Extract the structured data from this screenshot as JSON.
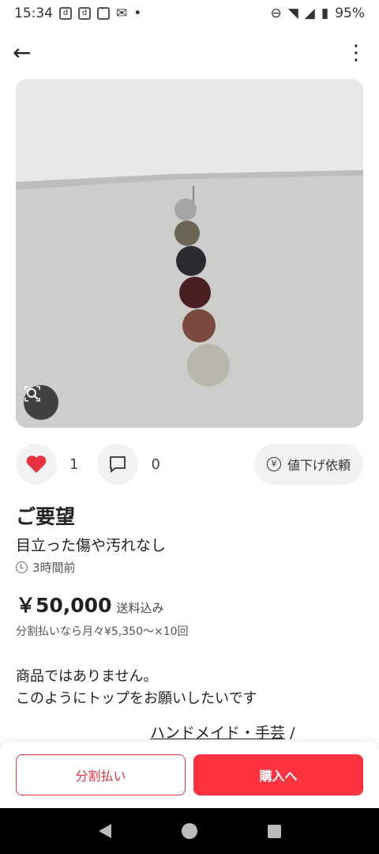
{
  "status": {
    "time": "15:34",
    "icons_left": [
      "d-icon",
      "d-box-icon",
      "sim-icon",
      "mail-icon",
      "dot-icon"
    ],
    "battery": "95%"
  },
  "header": {
    "back_icon": "back-arrow-icon",
    "more_icon": "more-vert-icon"
  },
  "product": {
    "likes_count": "1",
    "comments_count": "0",
    "price_drop_label": "値下げ依頼",
    "title": "ご要望",
    "condition": "目立った傷や汚れなし",
    "posted": "3時間前",
    "price": "￥50,000",
    "shipping": "送料込み",
    "installment": "分割払いなら月々¥5,350〜×10回",
    "description_line1": "商品ではありません。",
    "description_line2": "このようにトップをお願いしたいです",
    "category": "ハンドメイド・手芸",
    "category_sep": "/"
  },
  "footer": {
    "split_label": "分割払い",
    "buy_label": "購入へ"
  },
  "colors": {
    "accent": "#ff333f",
    "heart": "#e8323f"
  }
}
